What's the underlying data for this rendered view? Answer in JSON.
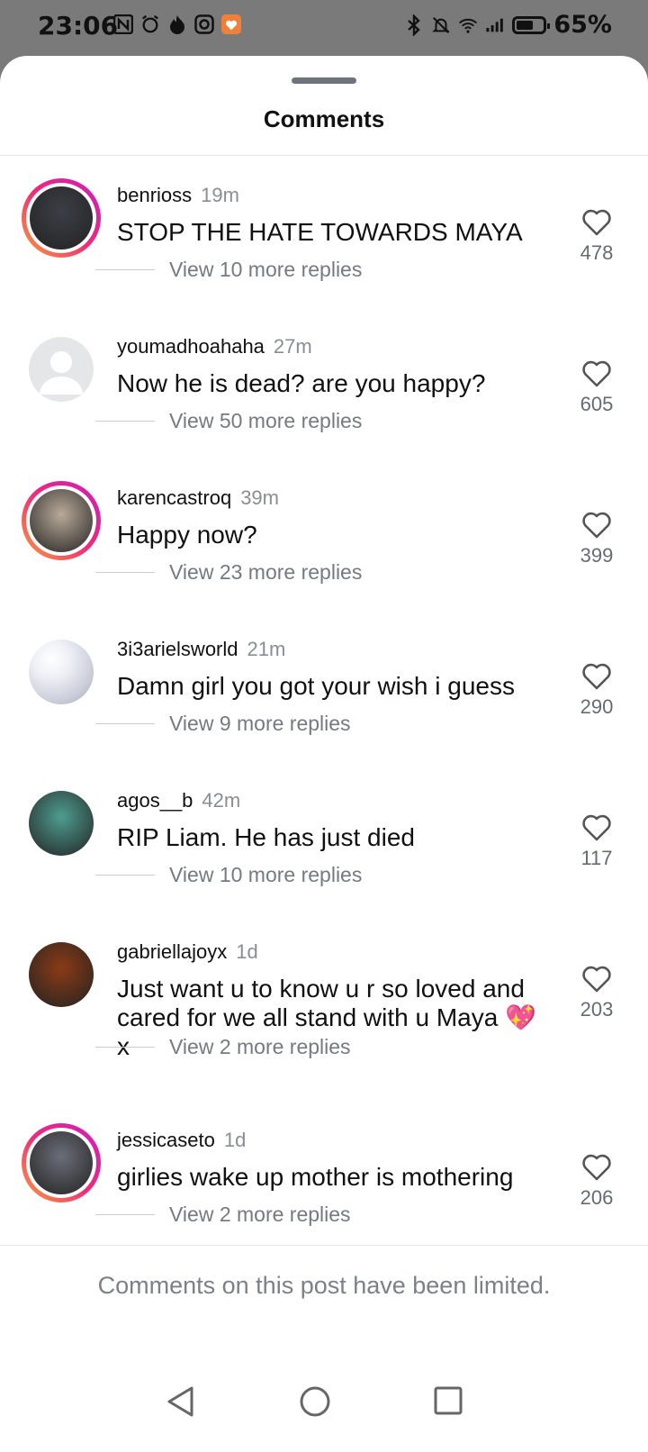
{
  "status_bar": {
    "time": "23:06",
    "left_icons": [
      "n-icon",
      "alarm-icon",
      "flame-icon",
      "instagram-icon",
      "heart-app-icon"
    ],
    "right_icons": [
      "bluetooth-icon",
      "mute-icon",
      "wifi-icon",
      "signal-icon"
    ],
    "battery_level": 0.65,
    "battery_text": "65%"
  },
  "sheet": {
    "title": "Comments"
  },
  "comments": [
    {
      "username": "benrioss",
      "time": "19m",
      "text": "STOP THE HATE TOWARDS MAYA",
      "likes": "478",
      "replies": "View 10 more replies",
      "ring": true,
      "avatar_color": "#3b3f46"
    },
    {
      "username": "youmadhoahaha",
      "time": "27m",
      "text": "Now he is dead? are you happy?",
      "likes": "605",
      "replies": "View 50 more replies",
      "ring": false,
      "avatar_color": "#e5e6e8"
    },
    {
      "username": "karencastroq",
      "time": "39m",
      "text": "Happy now?",
      "likes": "399",
      "replies": "View 23 more replies",
      "ring": true,
      "avatar_color": "#b9aa99"
    },
    {
      "username": "3i3arielsworld",
      "time": "21m",
      "text": "Damn girl you got your wish i guess",
      "likes": "290",
      "replies": "View 9 more replies",
      "ring": false,
      "avatar_color": "#d7dbe6"
    },
    {
      "username": "agos__b",
      "time": "42m",
      "text": "RIP Liam. He has just died",
      "likes": "117",
      "replies": "View 10 more replies",
      "ring": false,
      "avatar_color": "#4e9d8f"
    },
    {
      "username": "gabriellajoyx",
      "time": "1d",
      "text": "Just want u to know u r so loved and cared for we all stand with u Maya 💖 x",
      "likes": "203",
      "replies": "View 2 more replies",
      "ring": false,
      "avatar_color": "#8a3b16"
    },
    {
      "username": "jessicaseto",
      "time": "1d",
      "text": "girlies wake up mother is mothering",
      "likes": "206",
      "replies": "View 2 more replies",
      "ring": true,
      "avatar_color": "#6a6e78"
    }
  ],
  "footer": {
    "notice": "Comments on this post have been limited."
  },
  "nav": {
    "buttons": [
      "back-icon",
      "home-icon",
      "recents-icon"
    ]
  }
}
